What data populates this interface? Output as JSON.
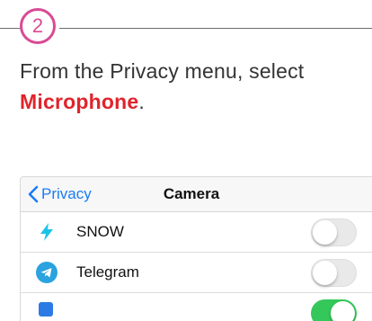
{
  "step": {
    "number": "2"
  },
  "instruction": {
    "text_before": "From the Privacy menu, select ",
    "highlight": "Microphone",
    "text_after": "."
  },
  "phone": {
    "navbar": {
      "back_label": "Privacy",
      "title": "Camera"
    },
    "apps": [
      {
        "name": "SNOW",
        "icon": "snow-bolt-icon",
        "enabled": false
      },
      {
        "name": "Telegram",
        "icon": "telegram-icon",
        "enabled": false
      },
      {
        "name": "",
        "icon": "app-icon",
        "enabled": true
      }
    ]
  },
  "colors": {
    "step_accent": "#d94a94",
    "highlight": "#e0242b",
    "ios_blue": "#1a7cf6",
    "toggle_on": "#34c759"
  }
}
